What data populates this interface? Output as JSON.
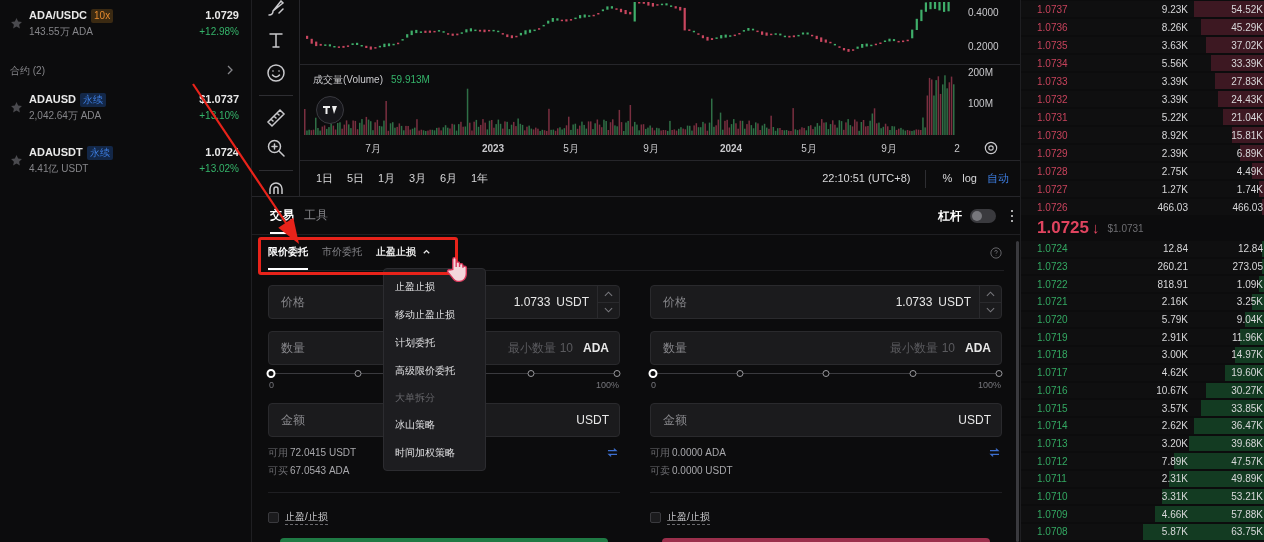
{
  "watchlist": {
    "spot": [
      {
        "symbol": "ADA/USDC",
        "badge": {
          "text": "10x",
          "kind": "leverage"
        },
        "volume": "143.55万 ADA",
        "price": "1.0729",
        "change": "+12.98%"
      }
    ],
    "section_title": "合约 (2)",
    "contracts": [
      {
        "symbol": "ADAUSD",
        "badge": {
          "text": "永续",
          "kind": "perpetual"
        },
        "volume": "2,042.64万 ADA",
        "price": "$1.0737",
        "change": "+13.10%"
      },
      {
        "symbol": "ADAUSDT",
        "badge": {
          "text": "永续",
          "kind": "perpetual"
        },
        "volume": "4.41亿 USDT",
        "price": "1.0724",
        "change": "+13.02%"
      }
    ]
  },
  "chart": {
    "price_ticks": [
      "0.4000",
      "0.2000"
    ],
    "volume_label": "成交量(Volume)",
    "volume_value": "59.913M",
    "volume_ticks": [
      "200M",
      "100M"
    ],
    "x_labels": [
      "7月",
      "2023",
      "5月",
      "9月",
      "2024",
      "5月",
      "9月",
      "2"
    ],
    "ranges": [
      "1日",
      "5日",
      "1月",
      "3月",
      "6月",
      "1年"
    ],
    "clock": "22:10:51 (UTC+8)",
    "scale_buttons": [
      {
        "label": "%",
        "selected": false
      },
      {
        "label": "log",
        "selected": false
      },
      {
        "label": "自动",
        "selected": true
      }
    ]
  },
  "trade": {
    "tabs": [
      {
        "label": "交易",
        "selected": true
      },
      {
        "label": "工具",
        "selected": false
      }
    ],
    "leverage": {
      "label": "杠杆",
      "on": false
    },
    "order_types": [
      {
        "label": "限价委托",
        "selected": true
      },
      {
        "label": "市价委托",
        "selected": false
      },
      {
        "label": "止盈止损",
        "selected": false,
        "expanded": true
      }
    ],
    "columns": [
      {
        "kind": "buy",
        "price": {
          "label": "价格",
          "value": "1.0733",
          "unit": "USDT"
        },
        "quantity": {
          "label": "数量",
          "placeholder": "最小数量 10",
          "unit": "ADA"
        },
        "slider": {
          "level": 0,
          "min_label": "0",
          "max_label": "100%"
        },
        "amount": {
          "label": "金额",
          "unit": "USDT"
        },
        "balances": [
          {
            "label": "可用",
            "value": "72.0415 USDT"
          },
          {
            "label": "可买",
            "value": "67.0543 ADA"
          }
        ],
        "tpsl": {
          "label": "止盈/止损",
          "checked": false
        }
      },
      {
        "kind": "sell",
        "price": {
          "label": "价格",
          "value": "1.0733",
          "unit": "USDT"
        },
        "quantity": {
          "label": "数量",
          "placeholder": "最小数量 10",
          "unit": "ADA"
        },
        "slider": {
          "level": 0,
          "min_label": "0",
          "max_label": "100%"
        },
        "amount": {
          "label": "金额",
          "unit": "USDT"
        },
        "balances": [
          {
            "label": "可用",
            "value": "0.0000 ADA"
          },
          {
            "label": "可卖",
            "value": "0.0000 USDT"
          }
        ],
        "tpsl": {
          "label": "止盈/止损",
          "checked": false
        }
      }
    ],
    "menu": [
      {
        "kind": "item",
        "label": "止盈止损"
      },
      {
        "kind": "item",
        "label": "移动止盈止损"
      },
      {
        "kind": "item",
        "label": "计划委托"
      },
      {
        "kind": "item",
        "label": "高级限价委托"
      },
      {
        "kind": "header",
        "label": "大单拆分"
      },
      {
        "kind": "item",
        "label": "冰山策略"
      },
      {
        "kind": "item",
        "label": "时间加权策略"
      }
    ]
  },
  "order_book": {
    "asks": [
      {
        "price": "1.0737",
        "size": "9.23K",
        "total": "54.52K",
        "level": 0.29
      },
      {
        "price": "1.0736",
        "size": "8.26K",
        "total": "45.29K",
        "level": 0.26
      },
      {
        "price": "1.0735",
        "size": "3.63K",
        "total": "37.02K",
        "level": 0.24
      },
      {
        "price": "1.0734",
        "size": "5.56K",
        "total": "33.39K",
        "level": 0.22
      },
      {
        "price": "1.0733",
        "size": "3.39K",
        "total": "27.83K",
        "level": 0.2
      },
      {
        "price": "1.0732",
        "size": "3.39K",
        "total": "24.43K",
        "level": 0.19
      },
      {
        "price": "1.0731",
        "size": "5.22K",
        "total": "21.04K",
        "level": 0.17
      },
      {
        "price": "1.0730",
        "size": "8.92K",
        "total": "15.81K",
        "level": 0.13
      },
      {
        "price": "1.0729",
        "size": "2.39K",
        "total": "6.89K",
        "level": 0.1
      },
      {
        "price": "1.0728",
        "size": "2.75K",
        "total": "4.49K",
        "level": 0.05
      },
      {
        "price": "1.0727",
        "size": "1.27K",
        "total": "1.74K",
        "level": 0.02
      },
      {
        "price": "1.0726",
        "size": "466.03",
        "total": "466.03",
        "level": 0.01
      }
    ],
    "last_price": "1.0725",
    "arrow": "↓",
    "index_price": "$1.0731",
    "bids": [
      {
        "price": "1.0724",
        "size": "12.84",
        "total": "12.84",
        "level": 0.01
      },
      {
        "price": "1.0723",
        "size": "260.21",
        "total": "273.05",
        "level": 0.01
      },
      {
        "price": "1.0722",
        "size": "818.91",
        "total": "1.09K",
        "level": 0.02
      },
      {
        "price": "1.0721",
        "size": "2.16K",
        "total": "3.25K",
        "level": 0.05
      },
      {
        "price": "1.0720",
        "size": "5.79K",
        "total": "9.04K",
        "level": 0.08
      },
      {
        "price": "1.0719",
        "size": "2.91K",
        "total": "11.96K",
        "level": 0.1
      },
      {
        "price": "1.0718",
        "size": "3.00K",
        "total": "14.97K",
        "level": 0.12
      },
      {
        "price": "1.0717",
        "size": "4.62K",
        "total": "19.60K",
        "level": 0.16
      },
      {
        "price": "1.0716",
        "size": "10.67K",
        "total": "30.27K",
        "level": 0.24
      },
      {
        "price": "1.0715",
        "size": "3.57K",
        "total": "33.85K",
        "level": 0.26
      },
      {
        "price": "1.0714",
        "size": "2.62K",
        "total": "36.47K",
        "level": 0.29
      },
      {
        "price": "1.0713",
        "size": "3.20K",
        "total": "39.68K",
        "level": 0.31
      },
      {
        "price": "1.0712",
        "size": "7.89K",
        "total": "47.57K",
        "level": 0.37
      },
      {
        "price": "1.0711",
        "size": "2.31K",
        "total": "49.89K",
        "level": 0.39
      },
      {
        "price": "1.0710",
        "size": "3.31K",
        "total": "53.21K",
        "level": 0.42
      },
      {
        "price": "1.0709",
        "size": "4.66K",
        "total": "57.88K",
        "level": 0.45
      },
      {
        "price": "1.0708",
        "size": "5.87K",
        "total": "63.75K",
        "level": 0.5
      }
    ]
  }
}
